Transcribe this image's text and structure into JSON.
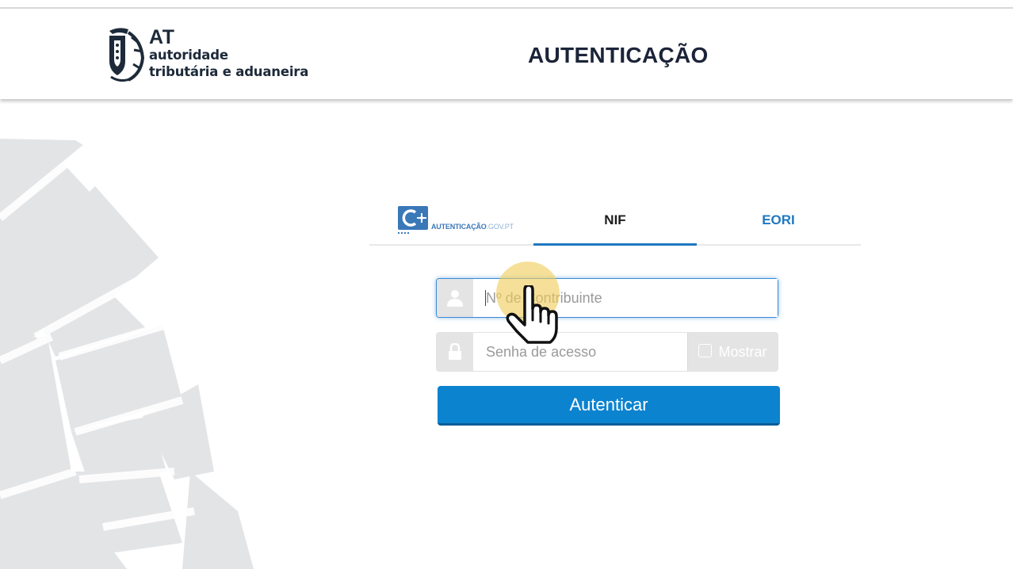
{
  "header": {
    "logo": {
      "abbr": "AT",
      "line1": "autoridade",
      "line2": "tributária e aduaneira"
    },
    "title": "AUTENTICAÇÃO"
  },
  "tabs": {
    "gov": {
      "label_main": "AUTENTICAÇÃO",
      "label_suffix": ".GOV.PT",
      "icon": "autenticacao-gov-icon"
    },
    "nif": {
      "label": "NIF",
      "active": true
    },
    "eori": {
      "label": "EORI"
    }
  },
  "form": {
    "nif": {
      "placeholder": "Nº de Contribuinte",
      "value": "",
      "icon": "user-icon"
    },
    "password": {
      "placeholder": "Senha de acesso",
      "value": "",
      "icon": "lock-icon",
      "show_label": "Mostrar",
      "show_checked": false
    },
    "submit_label": "Autenticar"
  },
  "colors": {
    "accent": "#0b83cf",
    "tab_active": "#1f78c1",
    "title": "#1b2438",
    "emblem": "#e3e4e6",
    "cursor_highlight": "#f0cd5a"
  }
}
